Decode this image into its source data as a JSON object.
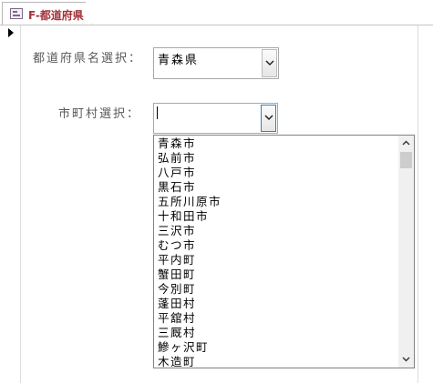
{
  "tab": {
    "title": "F-都道府県",
    "icon": "form-icon"
  },
  "form": {
    "prefecture_label": "都道府県名選択：",
    "prefecture_value": "青森県",
    "city_label": "市町村選択：",
    "city_value": ""
  },
  "city_list": {
    "items": [
      "青森市",
      "弘前市",
      "八戸市",
      "黒石市",
      "五所川原市",
      "十和田市",
      "三沢市",
      "むつ市",
      "平内町",
      "蟹田町",
      "今別町",
      "蓬田村",
      "平舘村",
      "三厩村",
      "鰺ヶ沢町",
      "木造町"
    ]
  },
  "colors": {
    "tab_title": "#a3323c",
    "label": "#595959",
    "focus_border": "#3c7fb1"
  }
}
